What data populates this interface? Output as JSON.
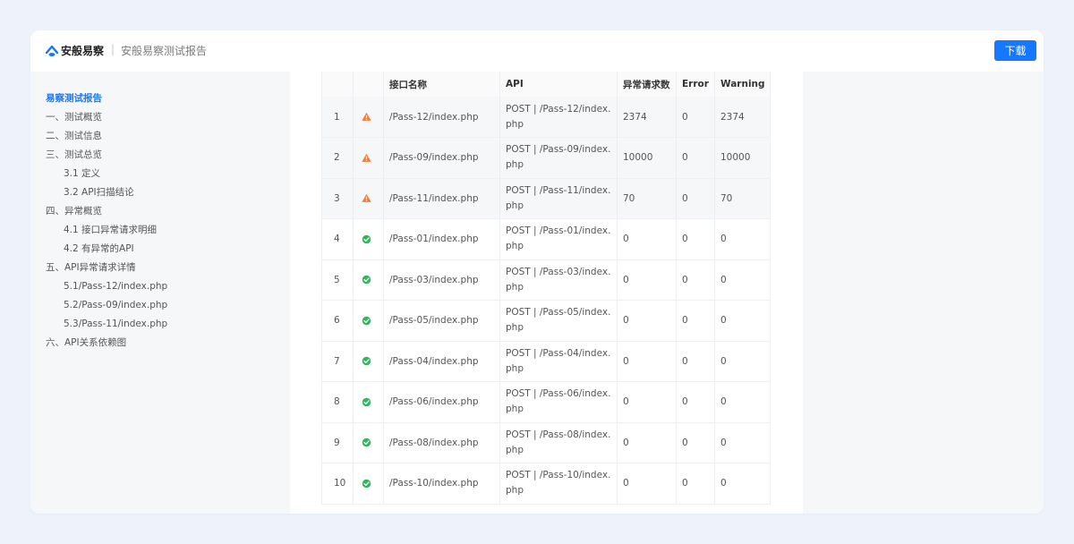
{
  "header": {
    "brand": "安般易察",
    "separator": "|",
    "title": "安般易察测试报告",
    "download_label": "下载",
    "accent_color": "#1677ff"
  },
  "sidebar": {
    "items": [
      {
        "label": "易察测试报告",
        "level": 0,
        "active": true
      },
      {
        "label": "一、测试概览",
        "level": 0
      },
      {
        "label": "二、测试信息",
        "level": 0
      },
      {
        "label": "三、测试总览",
        "level": 0
      },
      {
        "label": "3.1 定义",
        "level": 1
      },
      {
        "label": "3.2 API扫描结论",
        "level": 1
      },
      {
        "label": "四、异常概览",
        "level": 0
      },
      {
        "label": "4.1 接口异常请求明细",
        "level": 1
      },
      {
        "label": "4.2 有异常的API",
        "level": 1
      },
      {
        "label": "五、API异常请求详情",
        "level": 0
      },
      {
        "label": "5.1/Pass-12/index.php",
        "level": 1
      },
      {
        "label": "5.2/Pass-09/index.php",
        "level": 1
      },
      {
        "label": "5.3/Pass-11/index.php",
        "level": 1
      },
      {
        "label": "六、API关系依赖图",
        "level": 0
      }
    ]
  },
  "table": {
    "columns": [
      "",
      "",
      "接口名称",
      "API",
      "异常请求数",
      "Error",
      "Warning"
    ],
    "rows": [
      {
        "idx": "1",
        "status": "warning-icon",
        "name": "/Pass-12/index.php",
        "api": "POST | /Pass-12/index.php",
        "count": "2374",
        "error": "0",
        "warning": "2374"
      },
      {
        "idx": "2",
        "status": "warning-icon",
        "name": "/Pass-09/index.php",
        "api": "POST | /Pass-09/index.php",
        "count": "10000",
        "error": "0",
        "warning": "10000"
      },
      {
        "idx": "3",
        "status": "warning-icon",
        "name": "/Pass-11/index.php",
        "api": "POST | /Pass-11/index.php",
        "count": "70",
        "error": "0",
        "warning": "70"
      },
      {
        "idx": "4",
        "status": "check-circle-icon",
        "name": "/Pass-01/index.php",
        "api": "POST | /Pass-01/index.php",
        "count": "0",
        "error": "0",
        "warning": "0"
      },
      {
        "idx": "5",
        "status": "check-circle-icon",
        "name": "/Pass-03/index.php",
        "api": "POST | /Pass-03/index.php",
        "count": "0",
        "error": "0",
        "warning": "0"
      },
      {
        "idx": "6",
        "status": "check-circle-icon",
        "name": "/Pass-05/index.php",
        "api": "POST | /Pass-05/index.php",
        "count": "0",
        "error": "0",
        "warning": "0"
      },
      {
        "idx": "7",
        "status": "check-circle-icon",
        "name": "/Pass-04/index.php",
        "api": "POST | /Pass-04/index.php",
        "count": "0",
        "error": "0",
        "warning": "0"
      },
      {
        "idx": "8",
        "status": "check-circle-icon",
        "name": "/Pass-06/index.php",
        "api": "POST | /Pass-06/index.php",
        "count": "0",
        "error": "0",
        "warning": "0"
      },
      {
        "idx": "9",
        "status": "check-circle-icon",
        "name": "/Pass-08/index.php",
        "api": "POST | /Pass-08/index.php",
        "count": "0",
        "error": "0",
        "warning": "0"
      },
      {
        "idx": "10",
        "status": "check-circle-icon",
        "name": "/Pass-10/index.php",
        "api": "POST | /Pass-10/index.php",
        "count": "0",
        "error": "0",
        "warning": "0"
      }
    ],
    "warning_color": "#f07c3a",
    "ok_color": "#2fb85a"
  }
}
